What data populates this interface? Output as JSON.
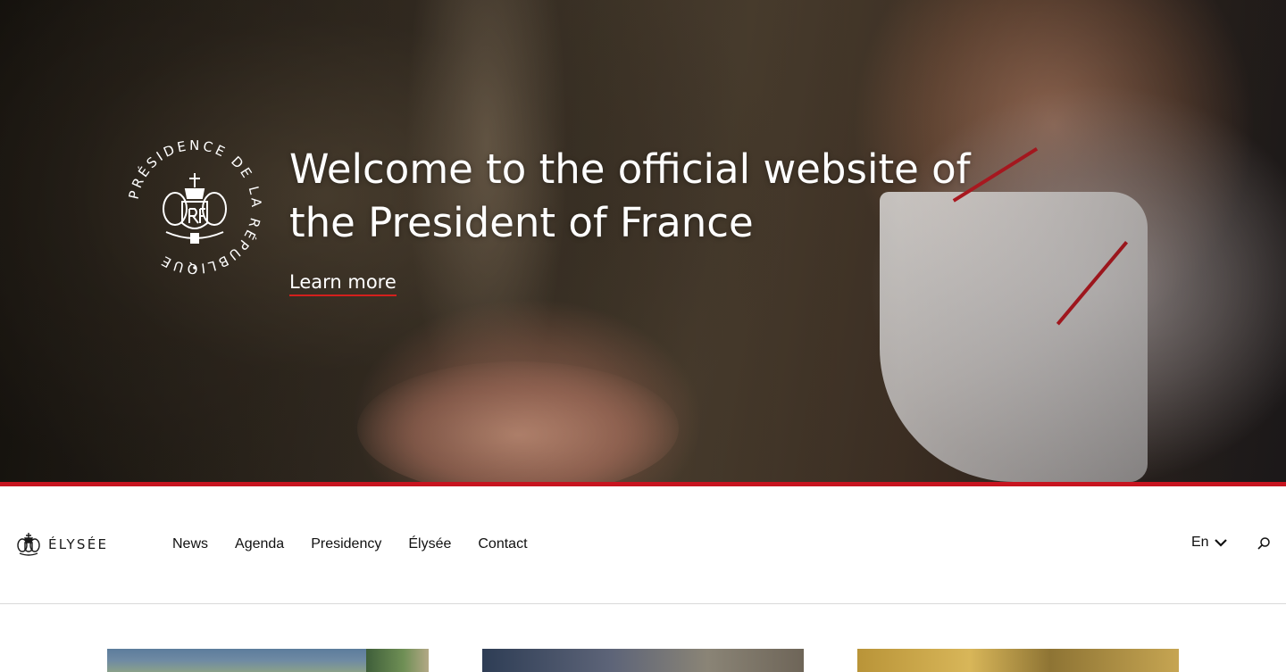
{
  "hero": {
    "title": "Welcome to the official website of the President of France",
    "cta_label": "Learn more",
    "seal_text": "PRÉSIDENCE DE LA RÉPUBLIQUE",
    "accent_color": "#c7141f"
  },
  "header": {
    "logo_text": "ÉLYSÉE",
    "nav": [
      {
        "label": "News"
      },
      {
        "label": "Agenda"
      },
      {
        "label": "Presidency"
      },
      {
        "label": "Élysée"
      },
      {
        "label": "Contact"
      }
    ],
    "language": "En",
    "icons": {
      "language": "chevron-down-icon",
      "search": "search-icon"
    }
  }
}
